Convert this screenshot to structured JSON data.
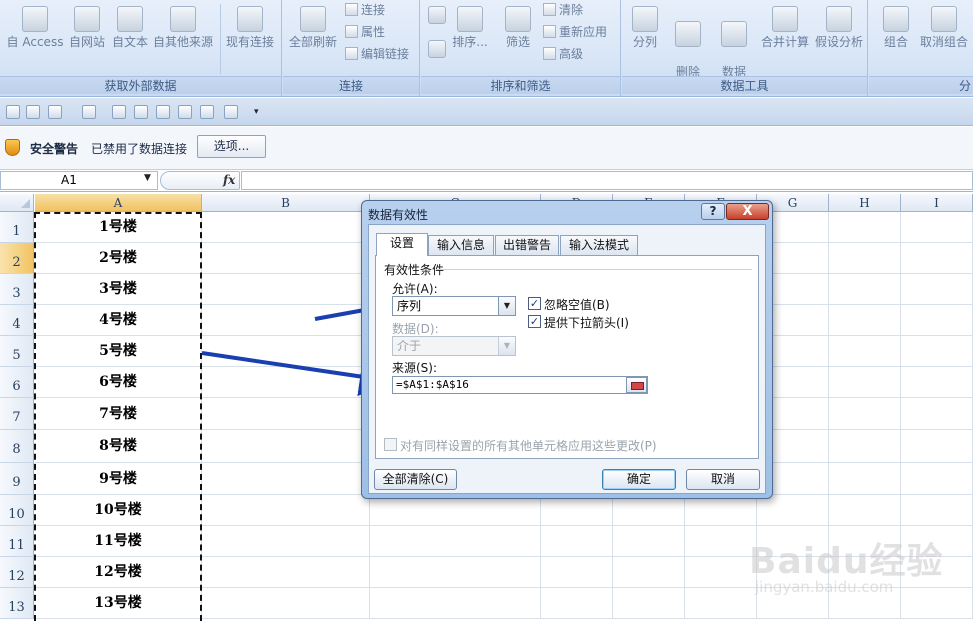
{
  "ribbon": {
    "groups": [
      {
        "label": "获取外部数据",
        "buttons": [
          "自 Access",
          "自网站",
          "自文本",
          "自其他来源",
          "现有连接"
        ]
      },
      {
        "label": "连接",
        "main": "全部刷新",
        "small": [
          "连接",
          "属性",
          "编辑链接"
        ]
      },
      {
        "label": "排序和筛选",
        "sort": "排序...",
        "filter": "筛选",
        "small": [
          "清除",
          "重新应用",
          "高级"
        ]
      },
      {
        "label": "数据工具",
        "buttons": [
          "分列",
          "删除\n重复项",
          "数据\n有效性·",
          "合并计算",
          "假设分析"
        ]
      },
      {
        "label": "分",
        "buttons": [
          "组合",
          "取消组合"
        ]
      }
    ]
  },
  "security": {
    "title": "安全警告",
    "message": "已禁用了数据连接",
    "options_label": "选项..."
  },
  "formula_bar": {
    "name_box": "A1",
    "fx": "fx",
    "content": ""
  },
  "grid": {
    "columns": [
      "A",
      "B",
      "C",
      "D",
      "E",
      "F",
      "G",
      "H",
      "I"
    ],
    "rows": [
      "1",
      "2",
      "3",
      "4",
      "5",
      "6",
      "7",
      "8",
      "9",
      "10",
      "11",
      "12",
      "13"
    ],
    "column_a_values": [
      "1号楼",
      "2号楼",
      "3号楼",
      "4号楼",
      "5号楼",
      "6号楼",
      "7号楼",
      "8号楼",
      "9号楼",
      "10号楼",
      "11号楼",
      "12号楼",
      "13号楼"
    ]
  },
  "dialog": {
    "title": "数据有效性",
    "help": "?",
    "close": "X",
    "tabs": [
      "设置",
      "输入信息",
      "出错警告",
      "输入法模式"
    ],
    "criteria_label": "有效性条件",
    "allow_label": "允许(A):",
    "allow_value": "序列",
    "ignore_blank_label": "忽略空值(B)",
    "ignore_blank_checked": true,
    "dropdown_label": "提供下拉箭头(I)",
    "dropdown_checked": true,
    "data_label": "数据(D):",
    "data_value": "介于",
    "source_label": "来源(S):",
    "source_value": "=$A$1:$A$16",
    "apply_all_label": "对有同样设置的所有其他单元格应用这些更改(P)",
    "apply_all_checked": false,
    "clear_all": "全部清除(C)",
    "ok": "确定",
    "cancel": "取消"
  },
  "watermark": {
    "main": "Baidu经验",
    "sub": "jingyan.baidu.com"
  },
  "colors": {
    "arrow": "#1a3fb0",
    "selection": "#f1c15f"
  }
}
